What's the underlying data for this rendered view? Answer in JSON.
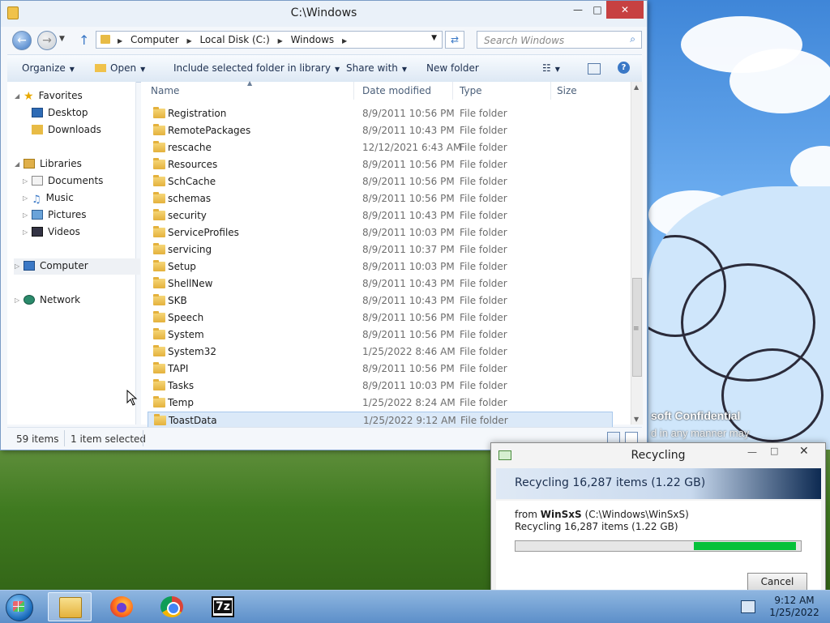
{
  "explorer": {
    "title": "C:\\Windows",
    "breadcrumbs": [
      "Computer",
      "Local Disk (C:)",
      "Windows"
    ],
    "search_placeholder": "Search Windows",
    "toolbar": {
      "organize": "Organize",
      "open": "Open",
      "include": "Include selected folder in library",
      "share": "Share with",
      "new_folder": "New folder"
    },
    "nav": {
      "favorites": "Favorites",
      "desktop": "Desktop",
      "downloads": "Downloads",
      "libraries": "Libraries",
      "documents": "Documents",
      "music": "Music",
      "pictures": "Pictures",
      "videos": "Videos",
      "computer": "Computer",
      "network": "Network"
    },
    "columns": {
      "name": "Name",
      "date": "Date modified",
      "type": "Type",
      "size": "Size"
    },
    "files": [
      {
        "name": "Registration",
        "date": "8/9/2011 10:56 PM",
        "type": "File folder"
      },
      {
        "name": "RemotePackages",
        "date": "8/9/2011 10:43 PM",
        "type": "File folder"
      },
      {
        "name": "rescache",
        "date": "12/12/2021 6:43 AM",
        "type": "File folder"
      },
      {
        "name": "Resources",
        "date": "8/9/2011 10:56 PM",
        "type": "File folder"
      },
      {
        "name": "SchCache",
        "date": "8/9/2011 10:56 PM",
        "type": "File folder"
      },
      {
        "name": "schemas",
        "date": "8/9/2011 10:56 PM",
        "type": "File folder"
      },
      {
        "name": "security",
        "date": "8/9/2011 10:43 PM",
        "type": "File folder"
      },
      {
        "name": "ServiceProfiles",
        "date": "8/9/2011 10:03 PM",
        "type": "File folder"
      },
      {
        "name": "servicing",
        "date": "8/9/2011 10:37 PM",
        "type": "File folder"
      },
      {
        "name": "Setup",
        "date": "8/9/2011 10:03 PM",
        "type": "File folder"
      },
      {
        "name": "ShellNew",
        "date": "8/9/2011 10:43 PM",
        "type": "File folder"
      },
      {
        "name": "SKB",
        "date": "8/9/2011 10:43 PM",
        "type": "File folder"
      },
      {
        "name": "Speech",
        "date": "8/9/2011 10:56 PM",
        "type": "File folder"
      },
      {
        "name": "System",
        "date": "8/9/2011 10:56 PM",
        "type": "File folder"
      },
      {
        "name": "System32",
        "date": "1/25/2022 8:46 AM",
        "type": "File folder"
      },
      {
        "name": "TAPI",
        "date": "8/9/2011 10:56 PM",
        "type": "File folder"
      },
      {
        "name": "Tasks",
        "date": "8/9/2011 10:03 PM",
        "type": "File folder"
      },
      {
        "name": "Temp",
        "date": "1/25/2022 8:24 AM",
        "type": "File folder"
      },
      {
        "name": "ToastData",
        "date": "1/25/2022 9:12 AM",
        "type": "File folder",
        "selected": true
      }
    ],
    "status": {
      "items": "59 items",
      "selected": "1 item selected"
    }
  },
  "recycle": {
    "title": "Recycling",
    "header": "Recycling 16,287 items (1.22 GB)",
    "from_label": "from",
    "from_name": "WinSxS",
    "from_path": "(C:\\Windows\\WinSxS)",
    "detail": "Recycling 16,287 items (1.22 GB)",
    "progress": 0.37,
    "cancel": "Cancel"
  },
  "desktop": {
    "watermark_1": "soft Confidential",
    "watermark_2": "d       in any manner may"
  },
  "taskbar": {
    "time": "9:12 AM",
    "date": "1/25/2022",
    "apps": [
      "Windows Explorer",
      "Firefox",
      "Google Chrome",
      "7-Zip"
    ]
  },
  "icons": {
    "back": "back-arrow-icon",
    "forward": "forward-arrow-icon",
    "up": "up-arrow-icon",
    "refresh": "refresh-icon",
    "search": "search-icon",
    "folder": "folder-icon"
  }
}
